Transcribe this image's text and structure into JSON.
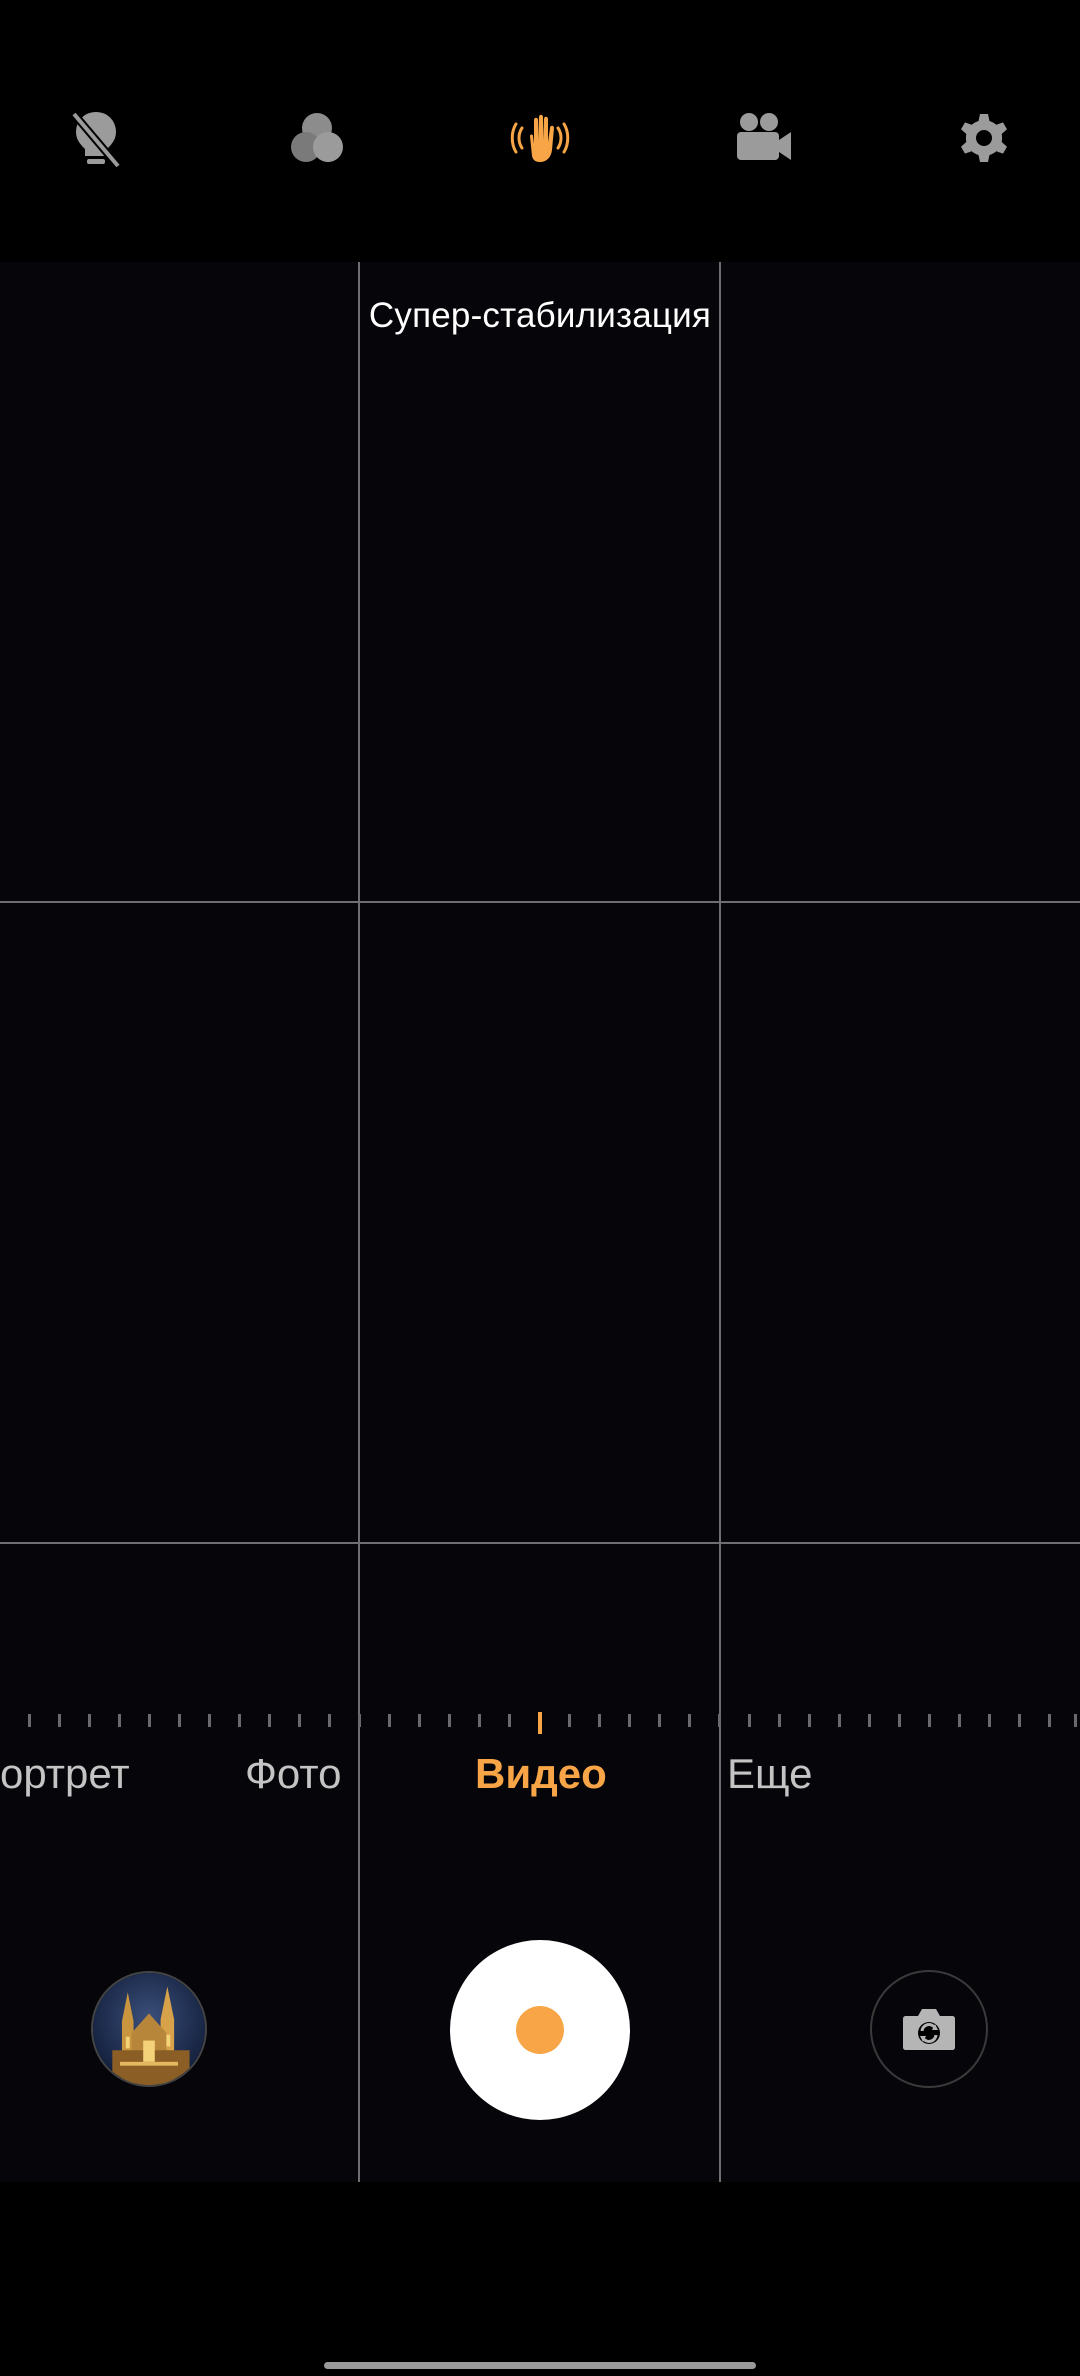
{
  "toolbar": {
    "icons": [
      {
        "name": "flash-off-icon",
        "active": false
      },
      {
        "name": "filters-icon",
        "active": false
      },
      {
        "name": "stabilization-icon",
        "active": true
      },
      {
        "name": "video-camera-icon",
        "active": false
      },
      {
        "name": "settings-icon",
        "active": false
      }
    ]
  },
  "viewfinder": {
    "label": "Супер-стабилизация"
  },
  "modes": {
    "items": [
      "ортрет",
      "Фото",
      "Видео",
      "Еще"
    ],
    "selected": "Видео"
  },
  "controls": {
    "gallery_icon": "gallery-thumbnail",
    "shutter_icon": "record-button",
    "switch_icon": "switch-camera-icon"
  },
  "colors": {
    "accent": "#f7a546",
    "background": "#000000",
    "grid": "#6f6f72"
  }
}
